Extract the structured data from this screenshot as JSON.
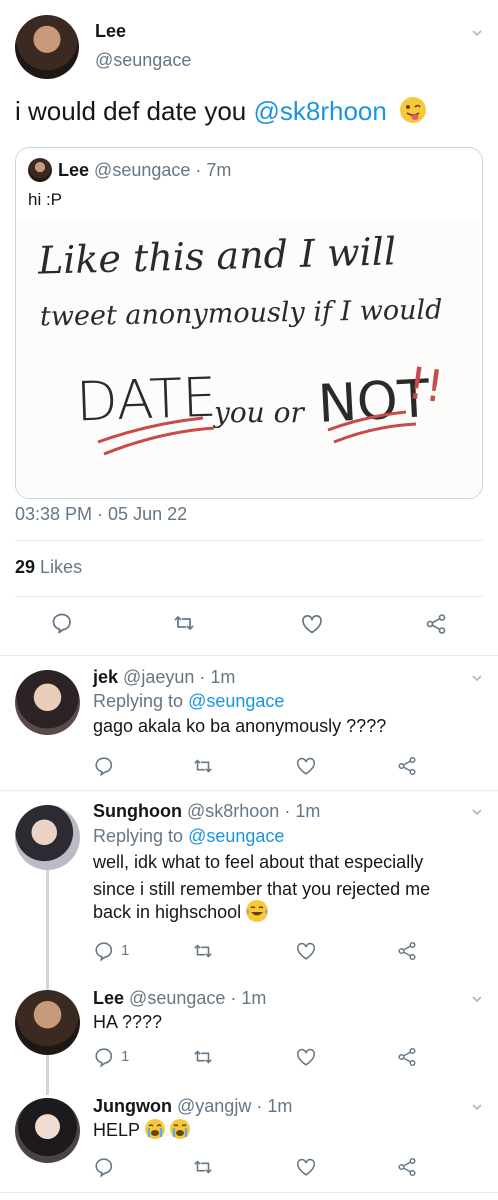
{
  "main_tweet": {
    "name": "Lee",
    "handle": "@seungace",
    "text_prefix": "i would def date you ",
    "mention": "@sk8rhoon",
    "emoji": "winking-tongue-emoji",
    "timestamp": "03:38 PM · 05 Jun 22",
    "likes_count": "29",
    "likes_label": "Likes"
  },
  "quoted_tweet": {
    "name": "Lee",
    "handle": "@seungace",
    "time": "· 7m",
    "text": "hi :P",
    "image_lines": [
      "Like this and I will",
      "tweet anonymously if I would",
      "DATE",
      "you or",
      "NOT",
      "!!"
    ]
  },
  "replies": [
    {
      "name": "jek",
      "handle": "@jaeyun",
      "time": "· 1m",
      "replying_prefix": "Replying to ",
      "replying_to": "@seungace",
      "lines": [
        "gago akala ko ba anonymously ????"
      ],
      "reply_count": ""
    },
    {
      "name": "Sunghoon",
      "handle": "@sk8rhoon",
      "time": "· 1m",
      "replying_prefix": "Replying to ",
      "replying_to": "@seungace",
      "lines": [
        "well, idk what to feel about that especially",
        "since i still remember that you rejected me",
        "back in highschool"
      ],
      "reply_count": "1"
    },
    {
      "name": "Lee",
      "handle": "@seungace",
      "time": "· 1m",
      "lines": [
        "HA ????"
      ],
      "reply_count": "1"
    },
    {
      "name": "Jungwon",
      "handle": "@yangjw",
      "time": "· 1m",
      "lines": [
        "HELP"
      ],
      "reply_count": ""
    }
  ],
  "colors": {
    "link": "#1b95e0",
    "gray": "#657786",
    "border": "#e6ecf0",
    "emoji": "#f7c83b"
  }
}
